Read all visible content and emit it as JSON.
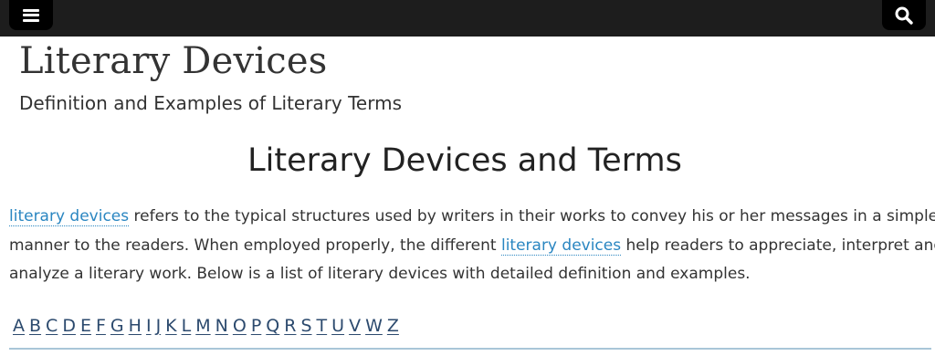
{
  "header": {
    "menu_icon": "menu-hamburger-icon",
    "search_icon": "search-icon",
    "bar_color": "#1d1d1d"
  },
  "site": {
    "title": "Literary Devices",
    "tagline": "Definition and Examples of Literary Terms"
  },
  "main": {
    "heading": "Literary Devices and Terms",
    "intro": {
      "line1_link": "literary devices",
      "line1_text": " refers to the typical structures used by writers in their works to convey his or her messages in a simple",
      "line2_text_before": "manner to the readers.  When employed properly, the different ",
      "line2_link": "literary devices",
      "line2_text_after": " help readers to appreciate, interpret and",
      "line3_text": "analyze a literary work. Below is a list of literary devices with detailed definition and examples."
    },
    "alphabet": [
      "A",
      "B",
      "C",
      "D",
      "E",
      "F",
      "G",
      "H",
      "I",
      "J",
      "K",
      "L",
      "M",
      "N",
      "O",
      "P",
      "Q",
      "R",
      "S",
      "T",
      "U",
      "V",
      "W",
      "Z"
    ]
  },
  "colors": {
    "link": "#2a86c1",
    "alphabet_link": "#2c4a6e",
    "divider": "#a9c6d8"
  }
}
